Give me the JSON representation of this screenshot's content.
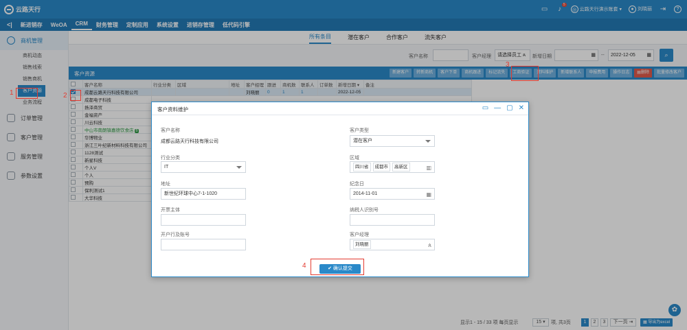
{
  "app": {
    "logo": "云路天行"
  },
  "topbar": {
    "notif_count": "5",
    "company": "云路天行演示账套",
    "user": "刘晓丽"
  },
  "nav": {
    "items": [
      "新进销存",
      "WeOA",
      "CRM",
      "财务管理",
      "定制应用",
      "系统设置",
      "进销存管理",
      "低代码引擎"
    ],
    "active_index": 2
  },
  "sidebar": {
    "groups": [
      {
        "label": "商机管理",
        "active": true,
        "subs": [
          "商机动态",
          "销售线索",
          "销售商机",
          "客户资源",
          "业务流程"
        ],
        "active_sub": 3
      },
      {
        "label": "订单管理"
      },
      {
        "label": "客户管理"
      },
      {
        "label": "服务管理"
      },
      {
        "label": "参数设置"
      }
    ]
  },
  "tabs": [
    "所有条目",
    "潜在客户",
    "合作客户",
    "流失客户"
  ],
  "search": {
    "name_label": "客户名称",
    "manager_label": "客户经理",
    "manager_placeholder": "请选择员工",
    "date_label": "新增日期",
    "date_sep": "--",
    "date_to": "2022-12-05"
  },
  "panel": {
    "title": "客户资源",
    "toolbar": [
      "新建客户",
      "转新商机",
      "客户下单",
      "商机跟进",
      "标记流失",
      "工商验证",
      "资料维护",
      "新增联系人",
      "申报费用",
      "操作日志",
      "删除",
      "批量修改客户"
    ]
  },
  "grid": {
    "columns": [
      "",
      "客户名称",
      "行业分类",
      "区域",
      "地址",
      "客户经理",
      "跟进",
      "商机数",
      "联系人",
      "订单数",
      "新增日期",
      "备注"
    ],
    "rows": [
      {
        "name": "成都云路天行科技有限公司",
        "checked": true,
        "manager": "刘晓丽",
        "follow": "0",
        "deals": "1",
        "contacts": "1",
        "date": "2022-12-05"
      },
      {
        "name": "成都电子科技"
      },
      {
        "name": "扬泽商贸"
      },
      {
        "name": "金福资产"
      },
      {
        "name": "川云科技"
      },
      {
        "name": "中山市南朗镇嘉德饮食店",
        "green": true,
        "tag": "B"
      },
      {
        "name": "华博物业"
      },
      {
        "name": "浙江三叶纪新材料科技有限公司"
      },
      {
        "name": "1128测试"
      },
      {
        "name": "新星科技"
      },
      {
        "name": "个人V"
      },
      {
        "name": "个人"
      },
      {
        "name": "预购"
      },
      {
        "name": "保利测试1"
      },
      {
        "name": "大华科技"
      }
    ]
  },
  "pager": {
    "summary": "显示1 - 15 / 33 项 每页显示",
    "page_size": "15",
    "suffix": "项, 共3页",
    "pages": [
      "1",
      "2",
      "3"
    ],
    "next": "下一页",
    "export": "导出为excel"
  },
  "modal": {
    "title": "客户资料维护",
    "name_label": "客户名称",
    "name_value": "成都云路天行科技有限公司",
    "type_label": "客户类型",
    "type_value": "潜在客户",
    "industry_label": "行业分类",
    "industry_value": "IT",
    "region_label": "区域",
    "region_parts": [
      "四川省",
      "成都市",
      "高新区"
    ],
    "address_label": "地址",
    "address_value": "新世纪环球中心7-1-1020",
    "anniv_label": "纪念日",
    "anniv_value": "2014-11-01",
    "invoice_label": "开票主体",
    "taxid_label": "纳税人识别号",
    "bank_label": "开户行及账号",
    "manager_label": "客户经理",
    "manager_value": "刘晓丽",
    "submit": "确认提交"
  },
  "annotations": [
    "1",
    "2",
    "3",
    "4"
  ],
  "colors": {
    "primary": "#2a89c9",
    "annotation": "#e33a2f",
    "success": "#2e9a45"
  }
}
